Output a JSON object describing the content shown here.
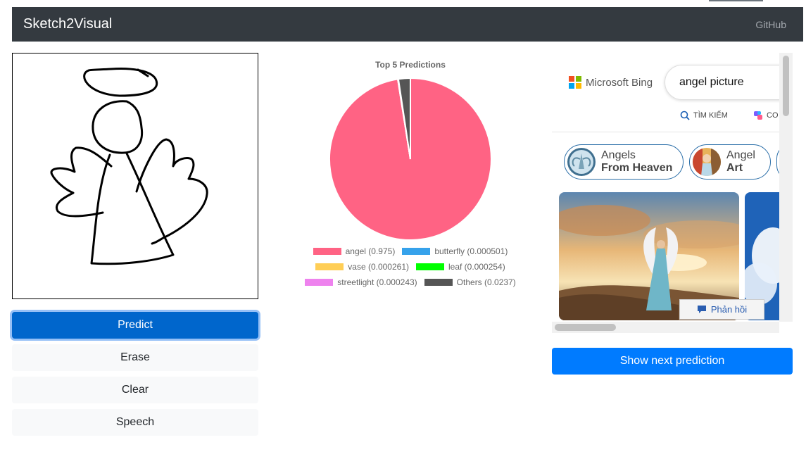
{
  "navbar": {
    "brand": "Sketch2Visual",
    "link": "GitHub"
  },
  "buttons": {
    "predict": "Predict",
    "erase": "Erase",
    "clear": "Clear",
    "speech": "Speech",
    "next": "Show next prediction"
  },
  "chart_data": {
    "type": "pie",
    "title": "Top 5 Predictions",
    "categories": [
      "angel",
      "butterfly",
      "vase",
      "leaf",
      "streetlight",
      "Others"
    ],
    "values": [
      0.975,
      0.000501,
      0.000261,
      0.000254,
      0.000243,
      0.0237
    ],
    "legend_labels": [
      "angel (0.975)",
      "butterfly (0.000501)",
      "vase (0.000261)",
      "leaf (0.000254)",
      "streetlight (0.000243)",
      "Others (0.0237)"
    ],
    "colors": [
      "#ff6384",
      "#36a2eb",
      "#ffce56",
      "#00ff00",
      "#ee82ee",
      "#555555"
    ],
    "legend_position": "bottom"
  },
  "bing": {
    "logo_text": "Microsoft Bing",
    "query": "angel picture",
    "tab_search": "TÌM KIẾM",
    "tab_copilot": "CO",
    "chips": [
      {
        "line1": "Angels",
        "line2": "From Heaven"
      },
      {
        "line1": "Angel",
        "line2": "Art"
      }
    ],
    "feedback": "Phản hồi"
  },
  "colors": {
    "navbar": "#343a40",
    "primary": "#007bff",
    "predict_active": "#0066cc"
  }
}
